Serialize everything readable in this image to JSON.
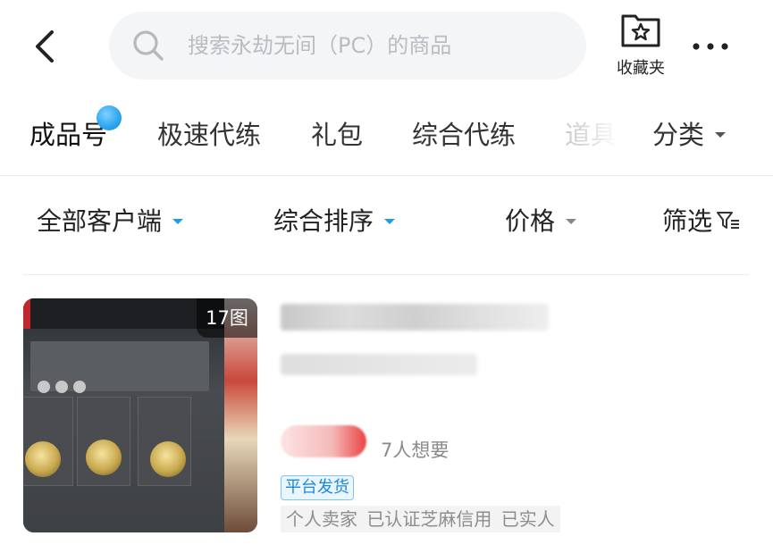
{
  "header": {
    "search_placeholder": "搜索永劫无间（PC）的商品",
    "favorites_label": "收藏夹"
  },
  "tabs": [
    {
      "label": "成品号",
      "active": true,
      "has_dot": true
    },
    {
      "label": "极速代练"
    },
    {
      "label": "礼包"
    },
    {
      "label": "综合代练"
    },
    {
      "label": "道具"
    }
  ],
  "category_label": "分类",
  "filters": {
    "client": "全部客户端",
    "sort": "综合排序",
    "price": "价格",
    "filter": "筛选"
  },
  "listing": {
    "image_count": "17图",
    "wants": "7人想要",
    "tag_platform": "平台发货",
    "tag_seller": "个人卖家 已认证芝麻信用 已实人"
  },
  "colors": {
    "accent": "#1e9bf0",
    "price_red": "#ea4343",
    "search_bg": "#f4f5f7"
  },
  "icons": [
    "back-arrow-icon",
    "search-icon",
    "favorites-star-icon",
    "more-dots-icon",
    "caret-down-icon",
    "filter-funnel-icon"
  ]
}
